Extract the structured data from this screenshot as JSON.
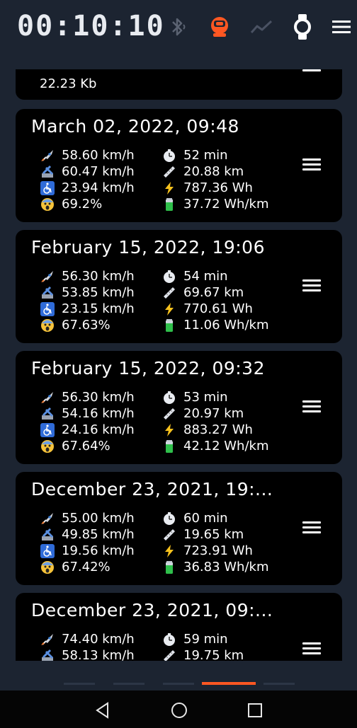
{
  "header": {
    "timer": "00:10:10",
    "icons": [
      "bluetooth-icon",
      "wheel-icon",
      "chart-icon",
      "watch-icon",
      "menu-icon"
    ],
    "accent_color": "#ff5722"
  },
  "partial_top": {
    "value": "22.23 Kb"
  },
  "trips": [
    {
      "title": "March 02, 2022, 09:48",
      "max_speed": "58.60 km/h",
      "gps_speed": "60.47 km/h",
      "avg_speed": "23.94 km/h",
      "battery_pct": "69.2%",
      "duration": "52 min",
      "distance": "20.88 km",
      "energy": "787.36 Wh",
      "consumption": "37.72 Wh/km"
    },
    {
      "title": "February 15, 2022, 19:06",
      "max_speed": "56.30 km/h",
      "gps_speed": "53.85 km/h",
      "avg_speed": "23.15 km/h",
      "battery_pct": "67.63%",
      "duration": "54 min",
      "distance": "69.67 km",
      "energy": "770.61 Wh",
      "consumption": "11.06 Wh/km"
    },
    {
      "title": "February 15, 2022, 09:32",
      "max_speed": "56.30 km/h",
      "gps_speed": "54.16 km/h",
      "avg_speed": "24.16 km/h",
      "battery_pct": "67.64%",
      "duration": "53 min",
      "distance": "20.97 km",
      "energy": "883.27 Wh",
      "consumption": "42.12 Wh/km"
    },
    {
      "title": "December 23, 2021, 19:...",
      "max_speed": "55.00 km/h",
      "gps_speed": "49.85 km/h",
      "avg_speed": "19.56 km/h",
      "battery_pct": "67.42%",
      "duration": "60 min",
      "distance": "19.65 km",
      "energy": "723.91 Wh",
      "consumption": "36.83 Wh/km"
    },
    {
      "title": "December 23, 2021, 09:...",
      "max_speed": "74.40 km/h",
      "gps_speed": "58.13 km/h",
      "duration": "59 min",
      "distance": "19.75 km"
    }
  ],
  "pager": {
    "pages": 5,
    "active_index": 3
  },
  "navbar": {
    "buttons": [
      "back-icon",
      "home-icon",
      "recents-icon"
    ]
  }
}
